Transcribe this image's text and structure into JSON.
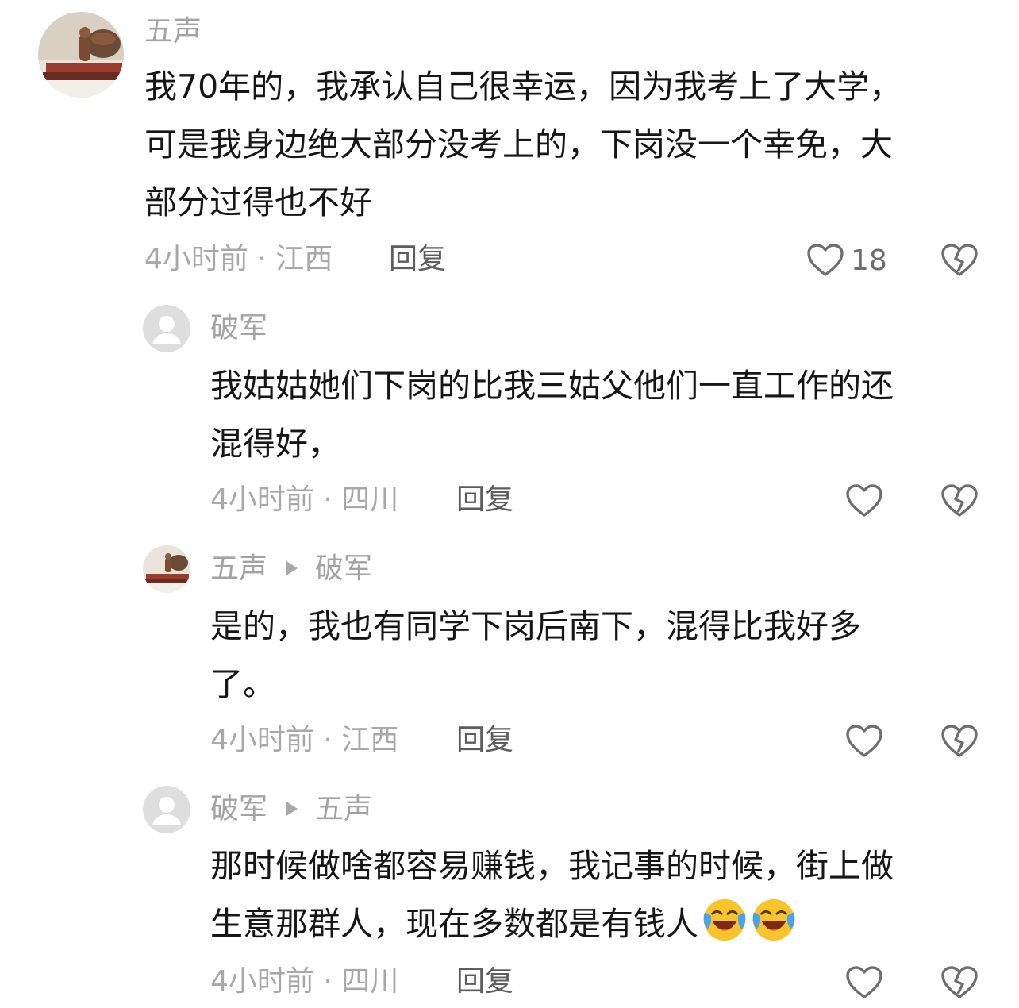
{
  "comments": [
    {
      "username": "五声",
      "lines": [
        "我70年的，我承认自己很幸运，因为我考上了大学，",
        "可是我身边绝大部分没考上的，下岗没一个幸免，大",
        "部分过得也不好"
      ],
      "meta": "4小时前 · 江西",
      "reply_label": "回复",
      "like_count": "18"
    },
    {
      "username": "破军",
      "lines": [
        "我姑姑她们下岗的比我三姑父他们一直工作的还",
        "混得好，"
      ],
      "meta": "4小时前 · 四川",
      "reply_label": "回复"
    },
    {
      "username": "五声",
      "reply_to": "破军",
      "lines": [
        "是的，我也有同学下岗后南下，混得比我好多",
        "了。"
      ],
      "meta": "4小时前 · 江西",
      "reply_label": "回复"
    },
    {
      "username": "破军",
      "reply_to": "五声",
      "lines": [
        "那时候做啥都容易赚钱，我记事的时候，街上做",
        "生意那群人，现在多数都是有钱人"
      ],
      "emojis": [
        "laugh-cry-icon",
        "laugh-cry-icon"
      ],
      "meta": "4小时前 · 四川",
      "reply_label": "回复"
    }
  ]
}
